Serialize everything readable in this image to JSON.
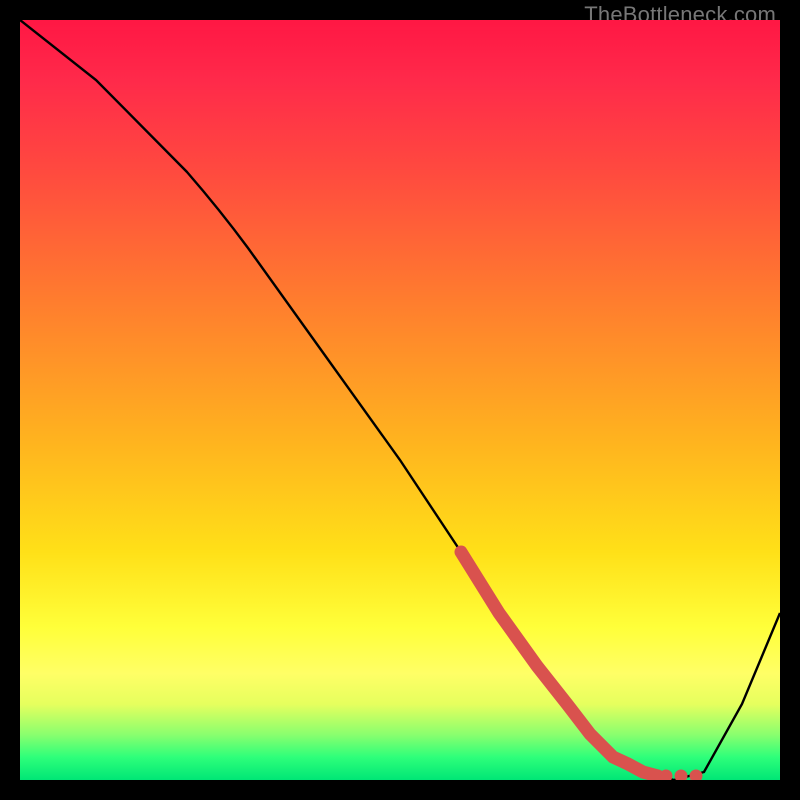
{
  "watermark": "TheBottleneck.com",
  "chart_data": {
    "type": "line",
    "title": "",
    "xlabel": "",
    "ylabel": "",
    "xlim": [
      0,
      100
    ],
    "ylim": [
      0,
      100
    ],
    "series": [
      {
        "name": "bottleneck-curve",
        "x": [
          0,
          10,
          22,
          30,
          40,
          50,
          58,
          63,
          68,
          73,
          78,
          82,
          86,
          90,
          95,
          100
        ],
        "y": [
          100,
          92,
          80,
          70,
          56,
          42,
          30,
          22,
          15,
          8,
          3,
          1,
          0,
          1,
          10,
          22
        ]
      }
    ],
    "highlight_segment": {
      "name": "dotted-highlight",
      "x": [
        58,
        63,
        68,
        72,
        75,
        78,
        80,
        82,
        84
      ],
      "y": [
        30,
        22,
        15,
        10,
        6,
        3,
        2,
        1,
        0.5
      ]
    },
    "highlight_dots": {
      "name": "trailing-dots",
      "points": [
        {
          "x": 85,
          "y": 0.5
        },
        {
          "x": 87,
          "y": 0.5
        },
        {
          "x": 89,
          "y": 0.5
        }
      ]
    },
    "gradient_note": "vertical red→yellow→green heat gradient background"
  }
}
